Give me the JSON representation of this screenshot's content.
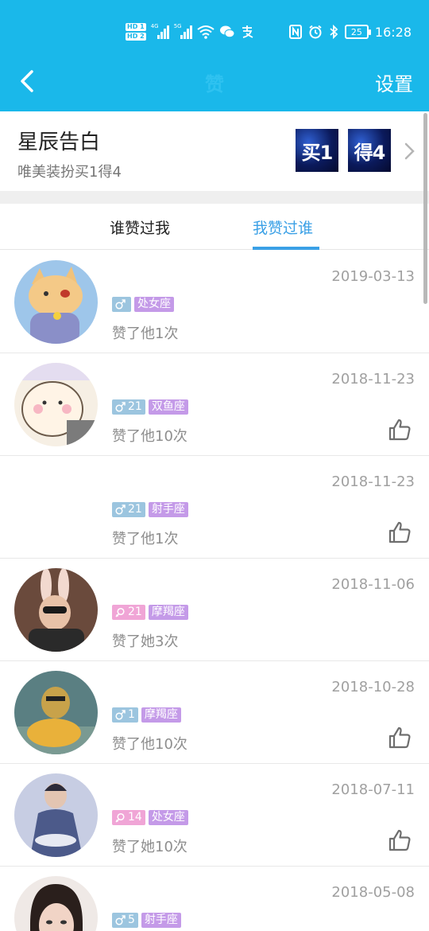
{
  "status_bar": {
    "hd1": "HD 1",
    "hd2": "HD 2",
    "net1": "4G",
    "net2": "5G",
    "battery": "25",
    "time": "16:28"
  },
  "nav": {
    "title": "赞",
    "settings": "设置"
  },
  "promo": {
    "title": "星辰告白",
    "subtitle": "唯美装扮买1得4",
    "badge1": "买1",
    "badge2": "得4"
  },
  "tabs": [
    {
      "label": "谁赞过我",
      "active": false
    },
    {
      "label": "我赞过谁",
      "active": true
    }
  ],
  "list": [
    {
      "date": "2019-03-13",
      "gender": "male",
      "age": "",
      "zodiac": "处女座",
      "text": "赞了他1次",
      "liked": false
    },
    {
      "date": "2018-11-23",
      "gender": "male",
      "age": "21",
      "zodiac": "双鱼座",
      "text": "赞了他10次",
      "liked": true
    },
    {
      "date": "2018-11-23",
      "gender": "male",
      "age": "21",
      "zodiac": "射手座",
      "text": "赞了他1次",
      "liked": true
    },
    {
      "date": "2018-11-06",
      "gender": "female",
      "age": "21",
      "zodiac": "摩羯座",
      "text": "赞了她3次",
      "liked": false
    },
    {
      "date": "2018-10-28",
      "gender": "male",
      "age": "1",
      "zodiac": "摩羯座",
      "text": "赞了他10次",
      "liked": true
    },
    {
      "date": "2018-07-11",
      "gender": "female",
      "age": "14",
      "zodiac": "处女座",
      "text": "赞了她10次",
      "liked": true
    },
    {
      "date": "2018-05-08",
      "gender": "male",
      "age": "5",
      "zodiac": "射手座",
      "text": "",
      "liked": false
    }
  ],
  "colors": {
    "header": "#1ab8ea",
    "tab_active": "#3aa0e6",
    "male_tag": "#9cc5df",
    "female_tag": "#f0a5d6",
    "zodiac_tag": "#c49ae8"
  }
}
